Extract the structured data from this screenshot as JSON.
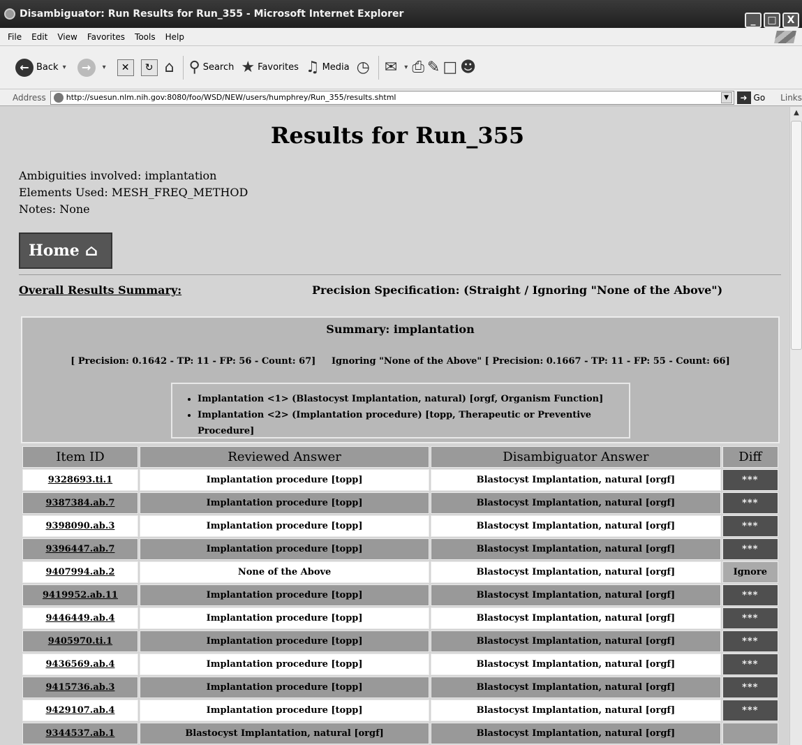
{
  "window": {
    "title": "Disambiguator: Run Results for Run_355 - Microsoft Internet Explorer",
    "buttons": [
      "_",
      "□",
      "X"
    ]
  },
  "menu": [
    "File",
    "Edit",
    "View",
    "Favorites",
    "Tools",
    "Help"
  ],
  "toolbar": {
    "back": "Back",
    "search": "Search",
    "favorites": "Favorites",
    "media": "Media"
  },
  "address": {
    "label": "Address",
    "url": "http://suesun.nlm.nih.gov:8080/foo/WSD/NEW/users/humphrey/Run_355/results.shtml",
    "go": "Go",
    "links": "Links"
  },
  "page": {
    "title": "Results for Run_355",
    "ambiguities": "Ambiguities involved: implantation",
    "elements": "Elements Used: MESH_FREQ_METHOD",
    "notes": "Notes: None",
    "home": "Home",
    "overall": "Overall Results Summary:",
    "precision_spec": "Precision Specification: (Straight / Ignoring \"None of the Above\")"
  },
  "summary": {
    "title": "Summary: implantation",
    "line": "[ Precision: 0.1642 - TP: 11 - FP: 56 - Count: 67]     Ignoring \"None of the Above\" [ Precision: 0.1667 - TP: 11 - FP: 55 - Count: 66]",
    "senses": [
      "Implantation <1> (Blastocyst Implantation, natural) [orgf, Organism Function]",
      "Implantation <2> (Implantation procedure) [topp, Therapeutic or Preventive Procedure]"
    ]
  },
  "table": {
    "headers": [
      "Item ID",
      "Reviewed Answer",
      "Disambiguator Answer",
      "Diff"
    ],
    "rows": [
      {
        "id": "9328693.ti.1",
        "reviewed": "Implantation procedure [topp]",
        "disamb": "Blastocyst Implantation, natural [orgf]",
        "diff": "***"
      },
      {
        "id": "9387384.ab.7",
        "reviewed": "Implantation procedure [topp]",
        "disamb": "Blastocyst Implantation, natural [orgf]",
        "diff": "***"
      },
      {
        "id": "9398090.ab.3",
        "reviewed": "Implantation procedure [topp]",
        "disamb": "Blastocyst Implantation, natural [orgf]",
        "diff": "***"
      },
      {
        "id": "9396447.ab.7",
        "reviewed": "Implantation procedure [topp]",
        "disamb": "Blastocyst Implantation, natural [orgf]",
        "diff": "***"
      },
      {
        "id": "9407994.ab.2",
        "reviewed": "None of the Above",
        "disamb": "Blastocyst Implantation, natural [orgf]",
        "diff": "Ignore"
      },
      {
        "id": "9419952.ab.11",
        "reviewed": "Implantation procedure [topp]",
        "disamb": "Blastocyst Implantation, natural [orgf]",
        "diff": "***"
      },
      {
        "id": "9446449.ab.4",
        "reviewed": "Implantation procedure [topp]",
        "disamb": "Blastocyst Implantation, natural [orgf]",
        "diff": "***"
      },
      {
        "id": "9405970.ti.1",
        "reviewed": "Implantation procedure [topp]",
        "disamb": "Blastocyst Implantation, natural [orgf]",
        "diff": "***"
      },
      {
        "id": "9436569.ab.4",
        "reviewed": "Implantation procedure [topp]",
        "disamb": "Blastocyst Implantation, natural [orgf]",
        "diff": "***"
      },
      {
        "id": "9415736.ab.3",
        "reviewed": "Implantation procedure [topp]",
        "disamb": "Blastocyst Implantation, natural [orgf]",
        "diff": "***"
      },
      {
        "id": "9429107.ab.4",
        "reviewed": "Implantation procedure [topp]",
        "disamb": "Blastocyst Implantation, natural [orgf]",
        "diff": "***"
      },
      {
        "id": "9344537.ab.1",
        "reviewed": "Blastocyst Implantation, natural [orgf]",
        "disamb": "Blastocyst Implantation, natural [orgf]",
        "diff": ""
      }
    ]
  }
}
